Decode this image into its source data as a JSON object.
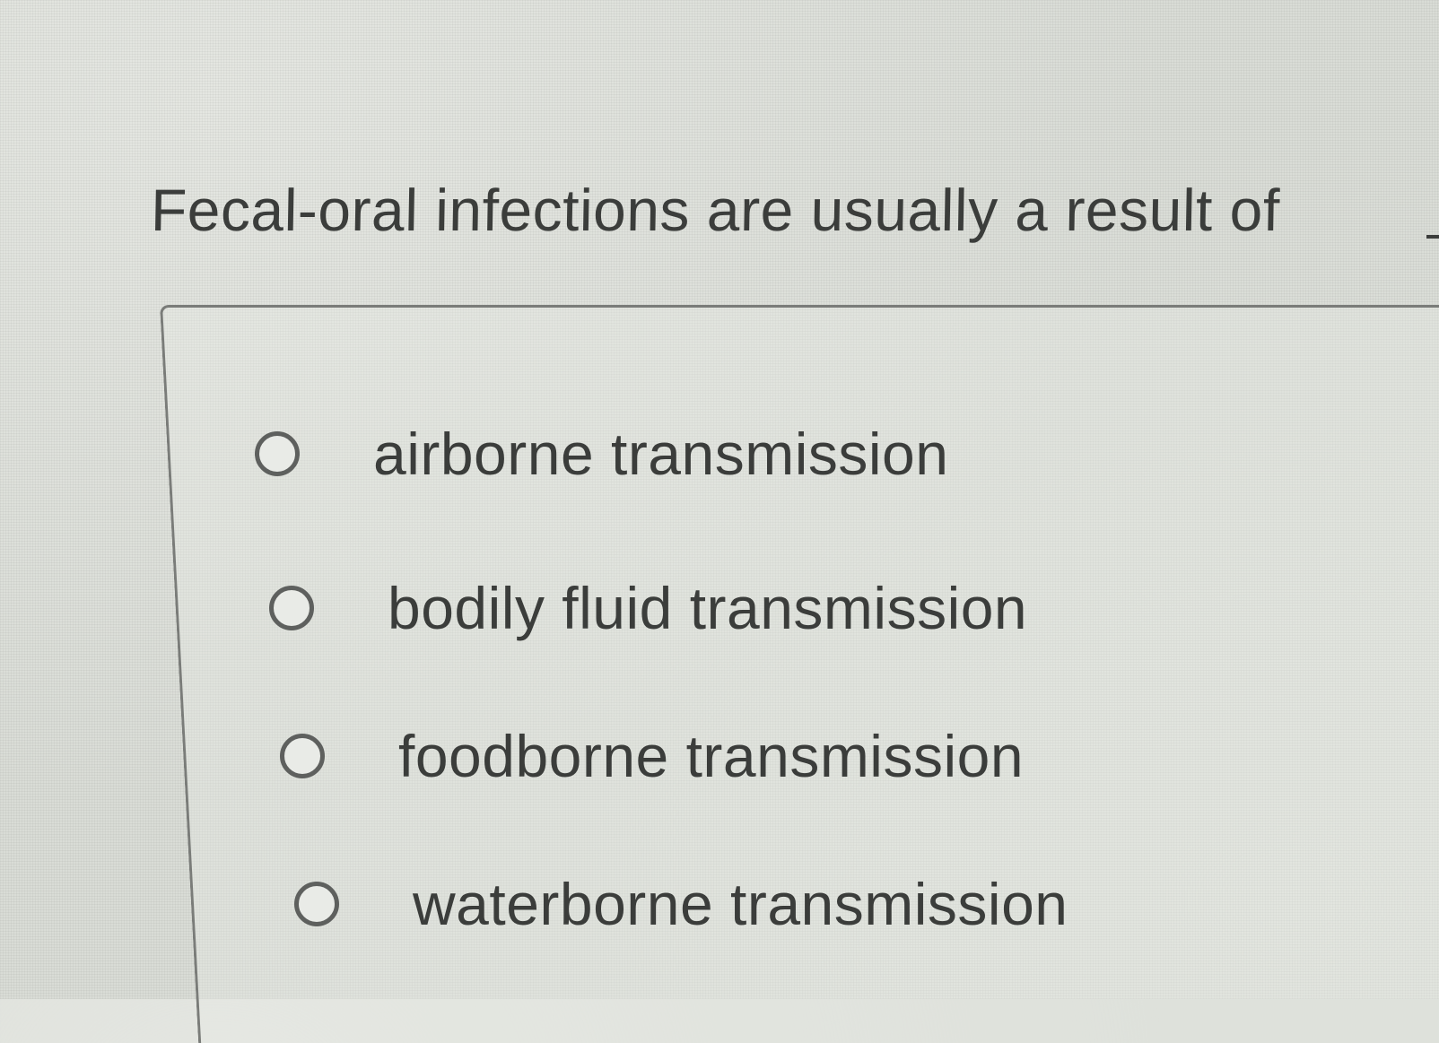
{
  "question": {
    "text": "Fecal-oral infections are usually a result of"
  },
  "options": [
    {
      "label": "airborne transmission",
      "selected": false
    },
    {
      "label": "bodily fluid transmission",
      "selected": false
    },
    {
      "label": "foodborne transmission",
      "selected": false
    },
    {
      "label": "waterborne transmission",
      "selected": false
    }
  ]
}
